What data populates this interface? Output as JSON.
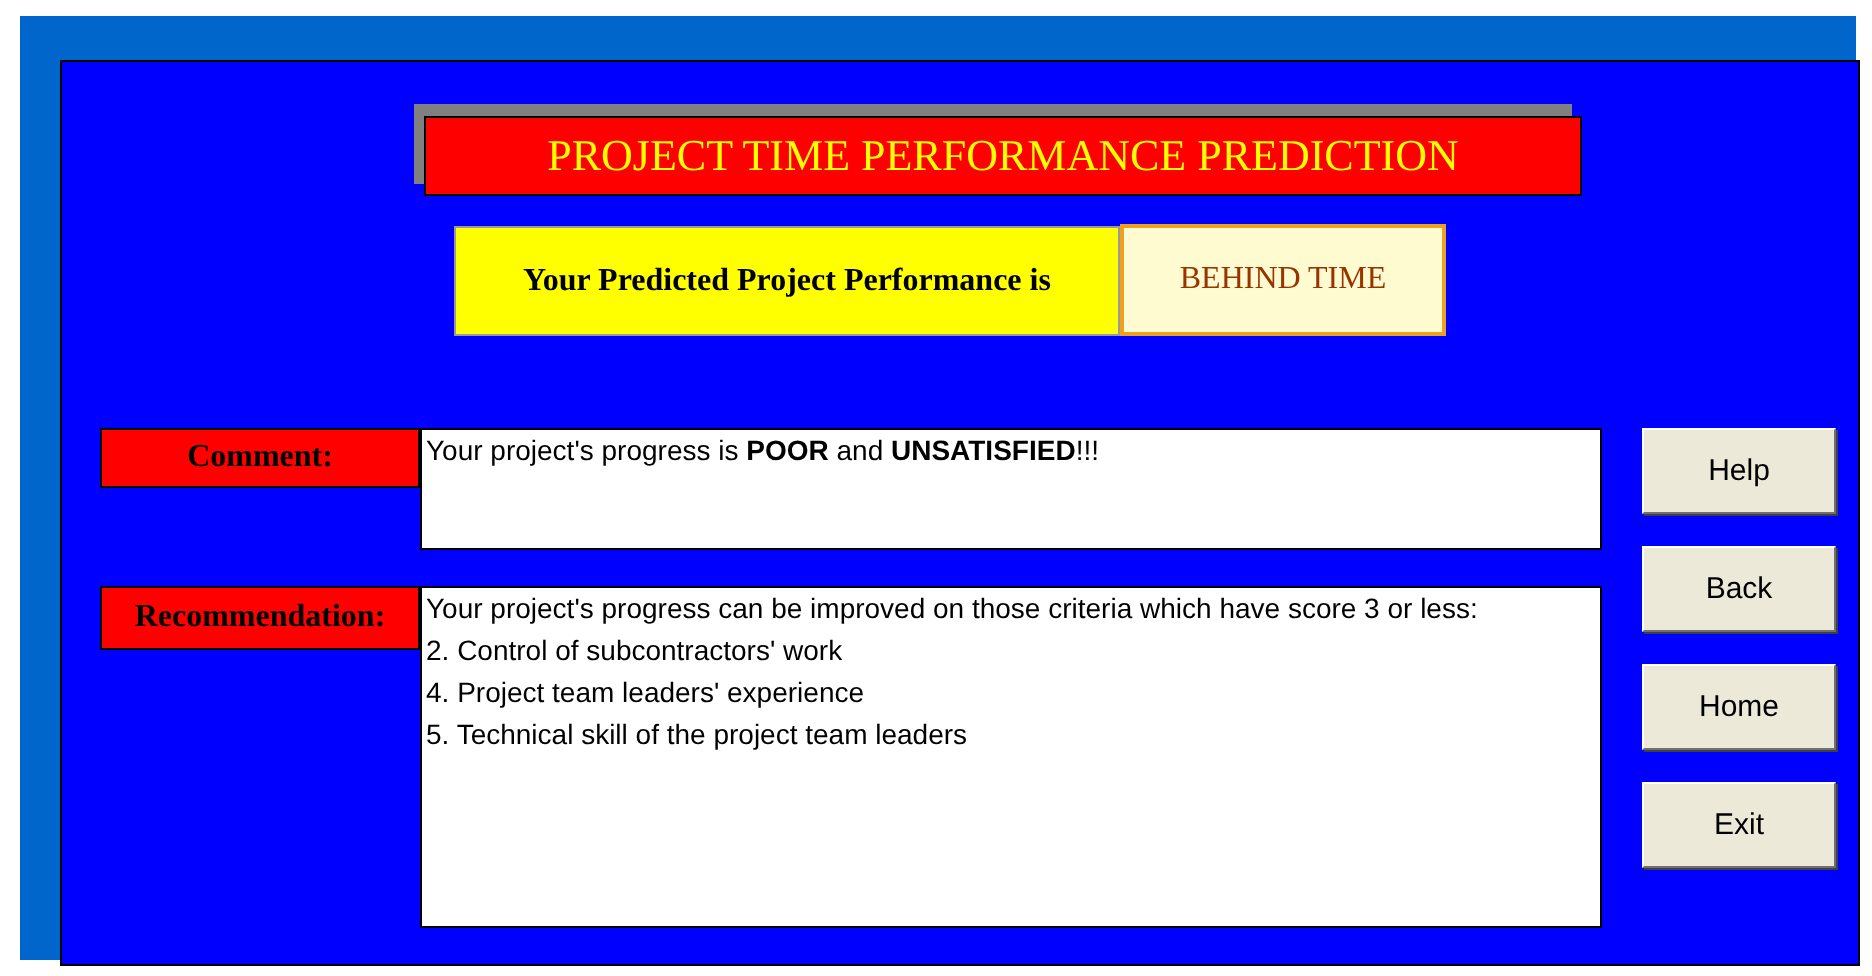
{
  "title": "PROJECT TIME PERFORMANCE PREDICTION",
  "prediction": {
    "label": "Your Predicted Project Performance is",
    "value": "BEHIND TIME"
  },
  "comment": {
    "label": "Comment:",
    "text": "Your project's progress is **POOR** and **UNSATISFIED**!!!"
  },
  "recommendation": {
    "label": "Recommendation:",
    "lines": [
      "Your project's progress can be improved on those criteria which have score 3 or less:",
      "2. Control of subcontractors' work",
      "4. Project team leaders' experience",
      "5. Technical skill of the project team leaders"
    ]
  },
  "buttons": [
    "Help",
    "Back",
    "Home",
    "Exit"
  ]
}
